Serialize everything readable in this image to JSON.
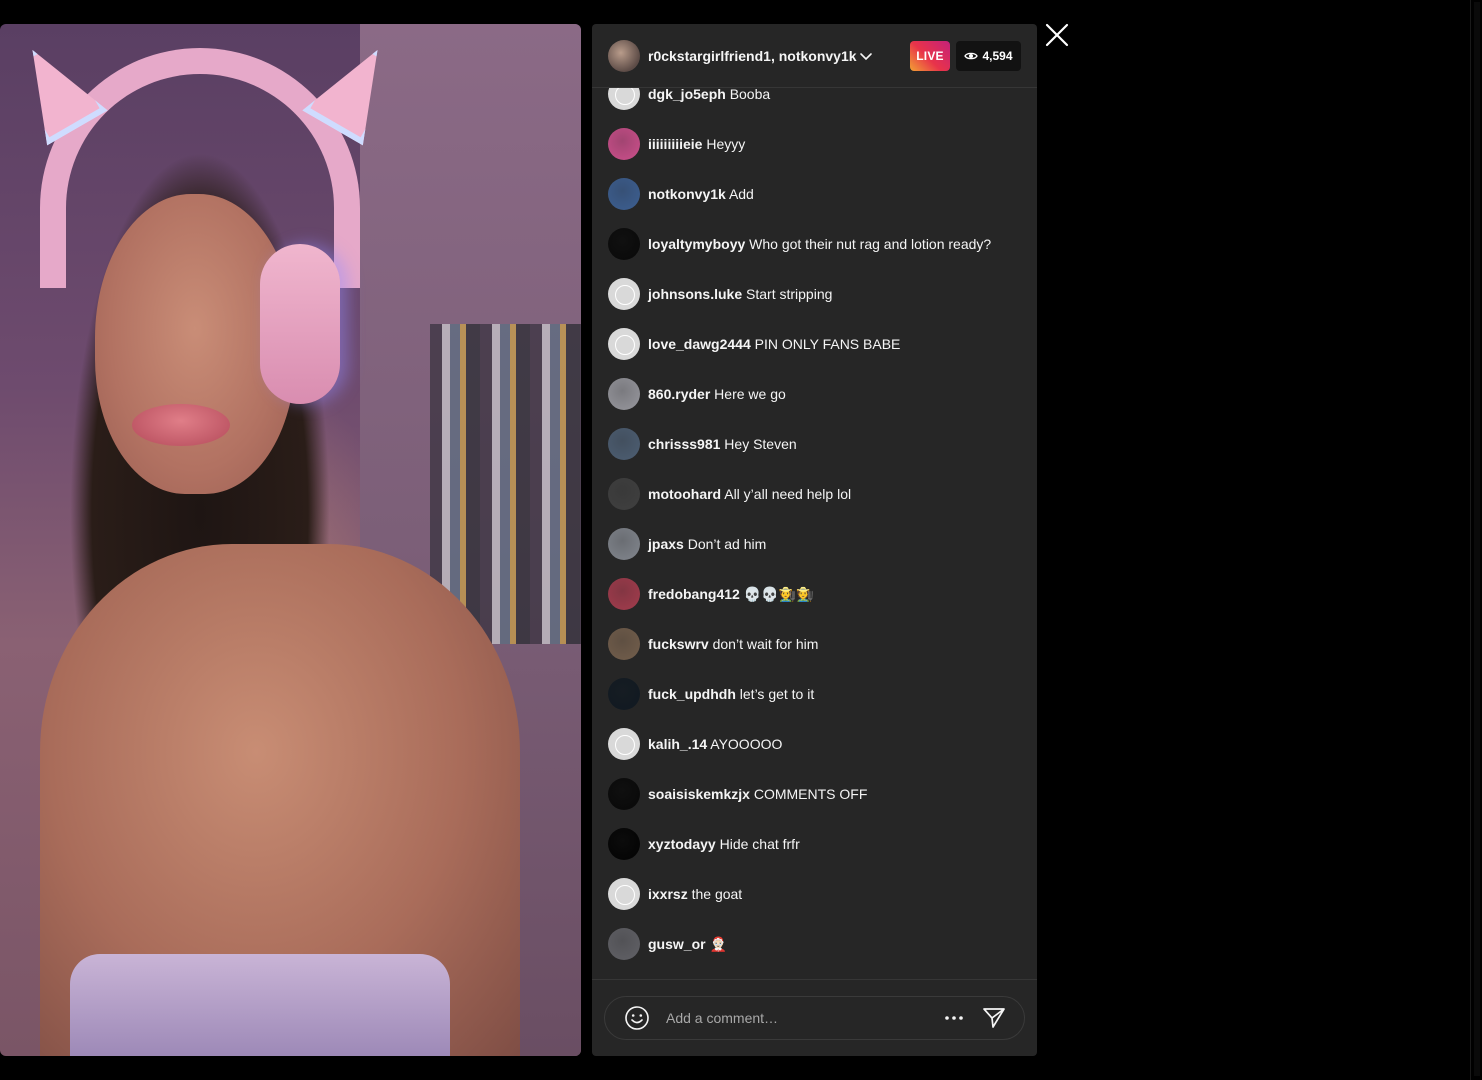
{
  "header": {
    "title": "r0ckstargirlfriend1, notkonvy1k",
    "live_label": "LIVE",
    "viewer_count": "4,594",
    "avatar_icon": "host-avatar"
  },
  "messages": [
    {
      "user": "dgk_jo5eph",
      "text": "Booba",
      "avatar": "default"
    },
    {
      "user": "iiiiiiiiieie",
      "text": "Heyyy",
      "avatar": "photo",
      "color": "#c04c84"
    },
    {
      "user": "notkonvy1k",
      "text": "Add",
      "avatar": "photo",
      "color": "#3b5b8a"
    },
    {
      "user": "loyaltymyboyy",
      "text": "Who got their nut rag and lotion ready?",
      "avatar": "photo",
      "color": "#0b0b0b"
    },
    {
      "user": "johnsons.luke",
      "text": "Start stripping",
      "avatar": "default"
    },
    {
      "user": "love_dawg2444",
      "text": "PIN ONLY FANS BABE",
      "avatar": "default"
    },
    {
      "user": "860.ryder",
      "text": "Here we go",
      "avatar": "photo",
      "color": "#8f8f95"
    },
    {
      "user": "chrisss981",
      "text": "Hey Steven",
      "avatar": "photo",
      "color": "#4a5a6d"
    },
    {
      "user": "motoohard",
      "text": "All y’all need help lol",
      "avatar": "photo",
      "color": "#3e3e3e"
    },
    {
      "user": "jpaxs",
      "text": "Don’t ad him",
      "avatar": "photo",
      "color": "#7b7f86"
    },
    {
      "user": "fredobang412",
      "text": "💀💀🧑‍🌾🧑‍🌾",
      "avatar": "photo",
      "color": "#9a3a4a"
    },
    {
      "user": "fuckswrv",
      "text": "don’t wait for him",
      "avatar": "photo",
      "color": "#6d5a49"
    },
    {
      "user": "fuck_updhdh",
      "text": "let’s get to it",
      "avatar": "photo",
      "color": "#121a22"
    },
    {
      "user": "kalih_.14",
      "text": "AYOOOOO",
      "avatar": "default"
    },
    {
      "user": "soaisiskemkzjx",
      "text": "COMMENTS OFF",
      "avatar": "photo",
      "color": "#0a0a0a"
    },
    {
      "user": "xyztodayy",
      "text": "Hide chat frfr",
      "avatar": "photo",
      "color": "#050505"
    },
    {
      "user": "ixxrsz",
      "text": "the goat",
      "avatar": "default"
    },
    {
      "user": "gusw_or",
      "text": "🤶🏻",
      "avatar": "photo",
      "color": "#5d5d62"
    }
  ],
  "composer": {
    "placeholder": "Add a comment…",
    "emoji_icon": "emoji-icon",
    "more_icon": "more-options-icon",
    "send_icon": "send-icon"
  },
  "icons": {
    "close": "close-icon",
    "chevron": "chevron-down-icon",
    "eye": "eye-icon"
  },
  "colors": {
    "panel_bg": "#262626",
    "page_bg": "#000000",
    "live_gradient_start": "#f2a134",
    "live_gradient_end": "#c5217a",
    "viewer_bg": "#121212"
  }
}
